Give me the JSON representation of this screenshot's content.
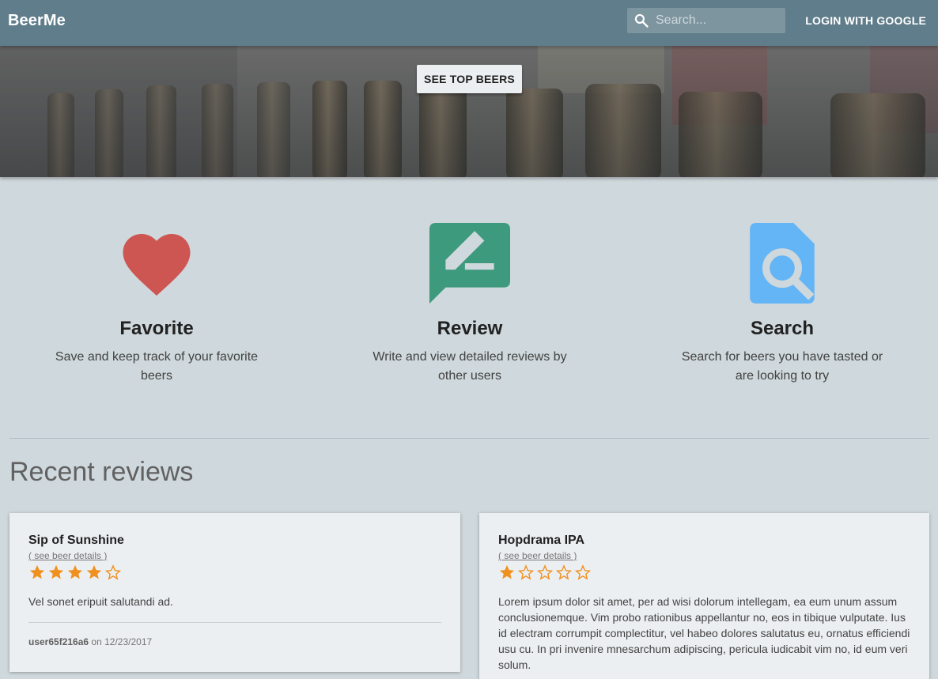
{
  "header": {
    "brand": "BeerMe",
    "search_placeholder": "Search...",
    "login_label": "LOGIN WITH GOOGLE"
  },
  "hero": {
    "button_label": "SEE TOP BEERS"
  },
  "features": [
    {
      "title": "Favorite",
      "description": "Save and keep track of your favorite beers",
      "icon": "heart-icon",
      "color": "#cd5552"
    },
    {
      "title": "Review",
      "description": "Write and view detailed reviews by other users",
      "icon": "rate-review-icon",
      "color": "#3d9a7c"
    },
    {
      "title": "Search",
      "description": "Search for beers you have tasted or are looking to try",
      "icon": "find-in-page-icon",
      "color": "#64b5f6"
    }
  ],
  "recent_reviews": {
    "title": "Recent reviews",
    "items": [
      {
        "beer": "Sip of Sunshine",
        "details_link": "( see beer details )",
        "rating": 4,
        "max_rating": 5,
        "text": "Vel sonet eripuit salutandi ad.",
        "user": "user65f216a6",
        "date_prefix": "on",
        "date": "12/23/2017"
      },
      {
        "beer": "Hopdrama IPA",
        "details_link": "( see beer details )",
        "rating": 1,
        "max_rating": 5,
        "text": "Lorem ipsum dolor sit amet, per ad wisi dolorum intellegam, ea eum unum assum conclusionemque. Vim probo rationibus appellantur no, eos in tibique vulputate. Ius id electram corrumpit complectitur, vel habeo dolores salutatus eu, ornatus efficiendi usu cu. In pri invenire mnesarchum adipiscing, pericula iudicabit vim no, id eum veri solum."
      }
    ]
  },
  "colors": {
    "header": "#607d8b",
    "background": "#cfd8dc",
    "card": "#eceff1",
    "star": "#f0901e"
  }
}
